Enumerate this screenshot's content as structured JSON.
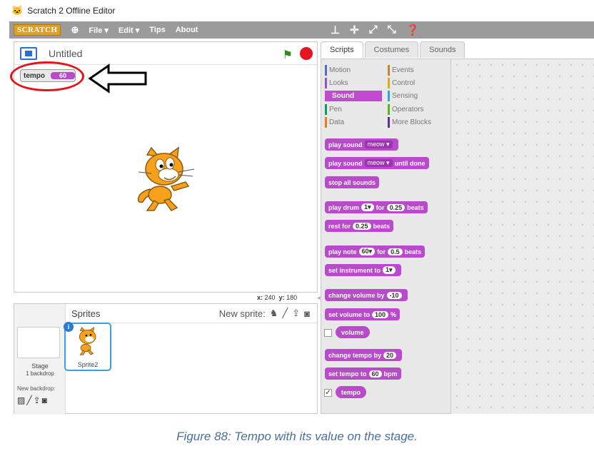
{
  "window": {
    "title": "Scratch 2 Offline Editor"
  },
  "menu": {
    "logo": "SCRATCH",
    "file": "File ▾",
    "edit": "Edit ▾",
    "tips": "Tips",
    "about": "About"
  },
  "stage": {
    "project_title": "Untitled",
    "monitor_label": "tempo",
    "monitor_value": "60",
    "coord_x_label": "x:",
    "coord_x": "240",
    "coord_y_label": "y:",
    "coord_y": "180"
  },
  "sprites_panel": {
    "title": "Sprites",
    "new_sprite": "New sprite:",
    "stage_label": "Stage",
    "stage_backdrops": "1 backdrop",
    "new_backdrop": "New backdrop:",
    "sprite_name": "Sprite2"
  },
  "tabs": [
    "Scripts",
    "Costumes",
    "Sounds"
  ],
  "categories": {
    "motion": "Motion",
    "looks": "Looks",
    "sound": "Sound",
    "pen": "Pen",
    "data": "Data",
    "events": "Events",
    "control": "Control",
    "sensing": "Sensing",
    "operators": "Operators",
    "more": "More Blocks"
  },
  "blocks": {
    "play_sound": "play sound",
    "meow": "meow",
    "play_sound_until": "until done",
    "stop_all": "stop all sounds",
    "play_drum": "play drum",
    "drum_val": "1",
    "for": "for",
    "drum_beats": "0.25",
    "beats": "beats",
    "rest_for": "rest for",
    "rest_beats": "0.25",
    "play_note": "play note",
    "note_val": "60",
    "note_beats": "0.5",
    "set_instrument": "set instrument to",
    "instrument_val": "1",
    "change_volume": "change volume by",
    "volume_delta": "-10",
    "set_volume": "set volume to",
    "volume_val": "100",
    "pct": "%",
    "volume": "volume",
    "change_tempo": "change tempo by",
    "tempo_delta": "20",
    "set_tempo": "set tempo to",
    "tempo_val": "60",
    "bpm": "bpm",
    "tempo": "tempo"
  },
  "caption": "Figure 88: Tempo with its value on the stage.",
  "colors": {
    "menubar": "#9b9b9b",
    "sound": "#b84acb",
    "highlight": "#e4121c"
  }
}
